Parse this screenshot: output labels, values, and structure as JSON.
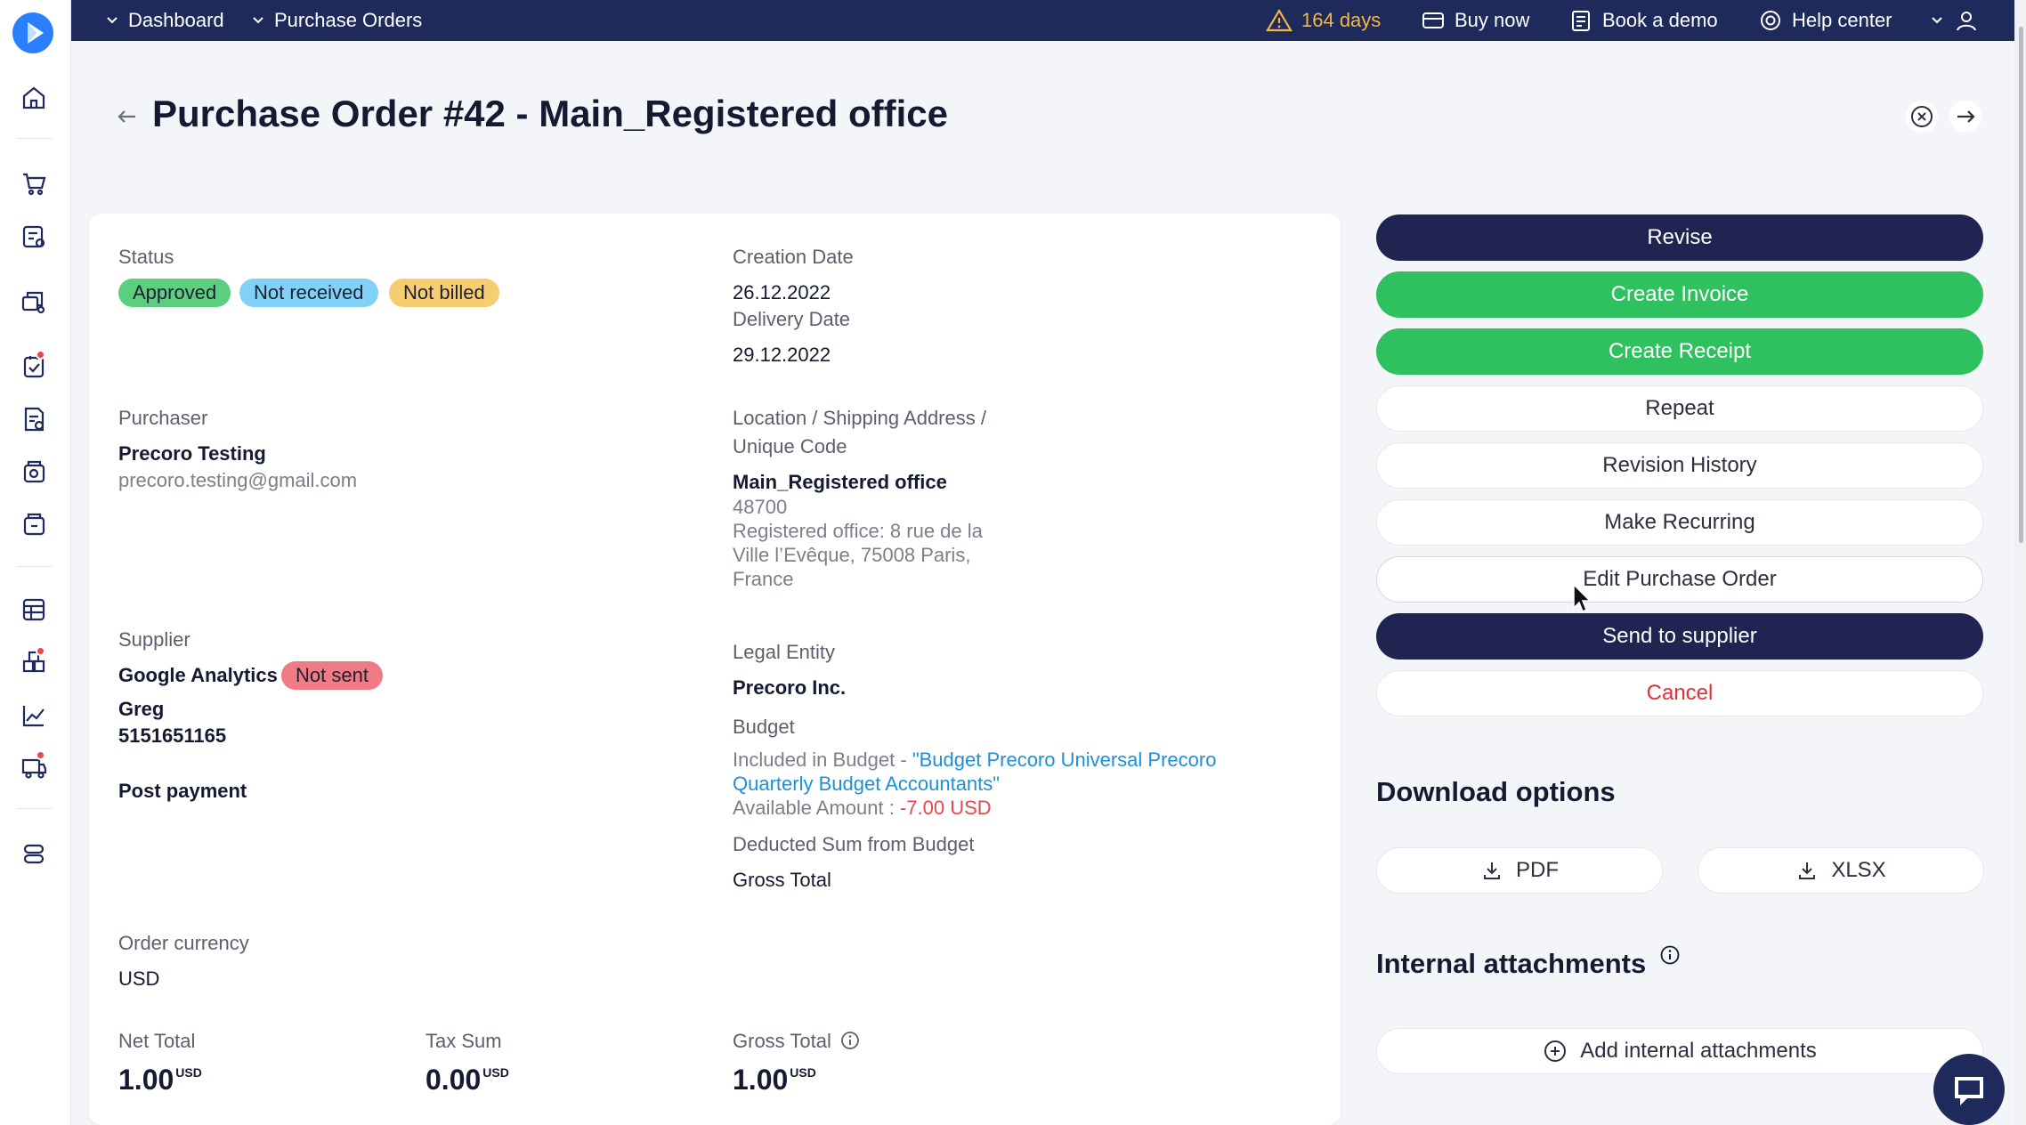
{
  "topbar": {
    "crumb1": "Dashboard",
    "crumb2": "Purchase Orders",
    "trial": "164 days",
    "buy_now": "Buy now",
    "book_demo": "Book a demo",
    "help_center": "Help center"
  },
  "page": {
    "title": "Purchase Order #42 - Main_Registered office"
  },
  "details": {
    "status_label": "Status",
    "badges": [
      "Approved",
      "Not received",
      "Not billed"
    ],
    "creation_date_label": "Creation Date",
    "creation_date": "26.12.2022",
    "delivery_date_label": "Delivery Date",
    "delivery_date": "29.12.2022",
    "purchaser_label": "Purchaser",
    "purchaser_name": "Precoro Testing",
    "purchaser_email": "precoro.testing@gmail.com",
    "location_label_1": "Location / Shipping Address /",
    "location_label_2": "Unique Code",
    "location_name": "Main_Registered office",
    "location_code": "48700",
    "address_1": "Registered office: 8 rue de la",
    "address_2": "Ville l’Evêque, 75008 Paris,",
    "address_3": "France",
    "supplier_label": "Supplier",
    "supplier_name": "Google Analytics",
    "supplier_badge": "Not sent",
    "contact_name": "Greg",
    "contact_phone": "5151651165",
    "payment_terms": "Post payment",
    "legal_entity_label": "Legal Entity",
    "legal_entity": "Precoro Inc.",
    "budget_label": "Budget",
    "budget_prefix": "Included in Budget - ",
    "budget_link_1": "\"Budget Precoro Universal Precoro",
    "budget_link_2": "Quarterly Budget Accountants\"",
    "available_prefix": "Available Amount : ",
    "available_amount": "-7.00 USD",
    "deducted_label": "Deducted Sum from Budget",
    "deducted_value": "Gross Total",
    "currency_label": "Order currency",
    "currency": "USD",
    "net_total_label": "Net Total",
    "net_total": "1.00",
    "tax_sum_label": "Tax Sum",
    "tax_sum": "0.00",
    "gross_total_label": "Gross Total",
    "gross_total": "1.00",
    "unit": "USD"
  },
  "actions": {
    "revise": "Revise",
    "create_invoice": "Create Invoice",
    "create_receipt": "Create Receipt",
    "repeat": "Repeat",
    "revision_history": "Revision History",
    "make_recurring": "Make Recurring",
    "edit_po": "Edit Purchase Order",
    "send_to_supplier": "Send to supplier",
    "cancel": "Cancel"
  },
  "downloads": {
    "title": "Download options",
    "pdf": "PDF",
    "xlsx": "XLSX"
  },
  "attachments": {
    "title": "Internal attachments",
    "add": "Add internal attachments"
  },
  "colors": {
    "topbar": "#1f2a5c",
    "primary_dark": "#1f2550",
    "success": "#2fc15f",
    "badge_approved": "#5ccf7e",
    "badge_not_received": "#7fd2f5",
    "badge_not_billed": "#f7cd72",
    "badge_not_sent": "#f07a85",
    "link": "#1f8fd6",
    "danger": "#e0303a"
  }
}
